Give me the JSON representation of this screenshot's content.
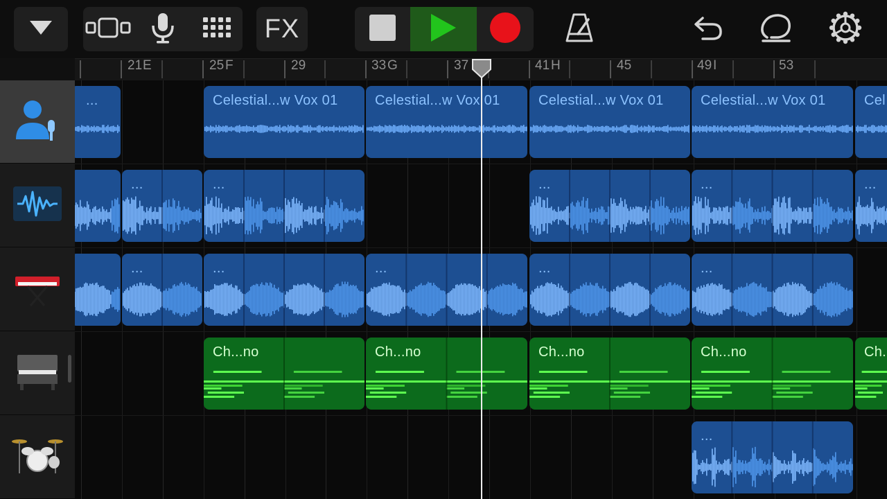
{
  "toolbar": {
    "buttons": [
      {
        "icon": "chevron-down-icon"
      },
      {
        "icon": "track-view-icon"
      },
      {
        "icon": "microphone-icon"
      },
      {
        "icon": "grid-icon"
      },
      {
        "label": "FX"
      }
    ],
    "transport": {
      "stop_icon": "stop-icon",
      "play_icon": "play-icon",
      "record_icon": "record-icon",
      "play_color": "#22c41c",
      "record_color": "#e8121a"
    },
    "right_icons": [
      "metronome-icon",
      "undo-icon",
      "loop-browser-icon",
      "settings-icon"
    ]
  },
  "ruler": {
    "bar_labels": [
      "21",
      "E",
      "25",
      "F",
      "29",
      "33",
      "G",
      "37",
      "41",
      "H",
      "45",
      "49",
      "I",
      "53"
    ],
    "add_label": "+"
  },
  "tracks": [
    {
      "icon": "vocal-mic-icon",
      "selected": true
    },
    {
      "icon": "audio-waveform-icon"
    },
    {
      "icon": "keyboard-synth-icon"
    },
    {
      "icon": "electric-piano-icon"
    },
    {
      "icon": "drum-kit-icon"
    }
  ],
  "regions": {
    "track1": [
      {
        "label": "..."
      },
      {
        "label": "Celestial...w Vox 01"
      },
      {
        "label": "Celestial...w Vox 01"
      },
      {
        "label": "Celestial...w Vox 01"
      },
      {
        "label": "Celestial...w Vox 01"
      },
      {
        "label": "Cel"
      }
    ],
    "track2": [
      {
        "label": "..."
      },
      {
        "label": "..."
      },
      {
        "label": "..."
      },
      {
        "label": "..."
      },
      {
        "label": "..."
      }
    ],
    "track3": [
      {
        "label": "..."
      },
      {
        "label": "..."
      },
      {
        "label": "..."
      },
      {
        "label": "..."
      },
      {
        "label": "..."
      }
    ],
    "track4": [
      {
        "label": "Ch...no"
      },
      {
        "label": "Ch...no"
      },
      {
        "label": "Ch...no"
      },
      {
        "label": "Ch...no"
      },
      {
        "label": "Ch..."
      }
    ],
    "track5": [
      {
        "label": "..."
      }
    ]
  }
}
